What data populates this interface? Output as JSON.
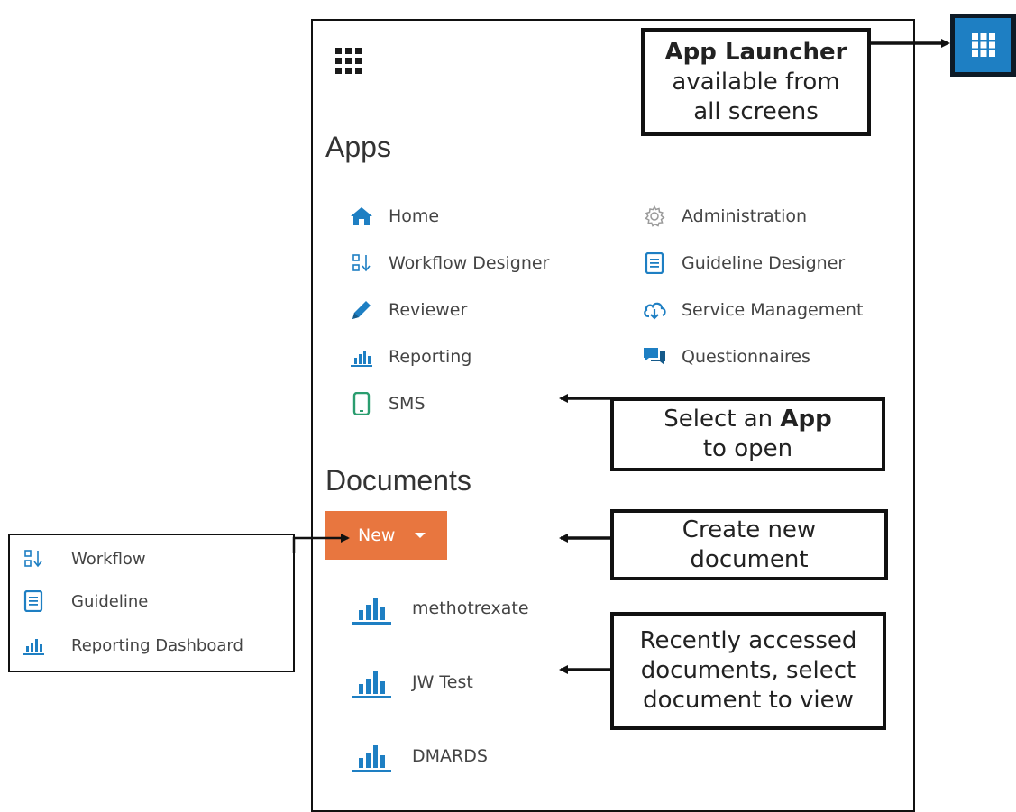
{
  "panel": {
    "apps_heading": "Apps",
    "apps": [
      {
        "label": "Home",
        "icon": "home-icon"
      },
      {
        "label": "Workflow Designer",
        "icon": "workflow-icon"
      },
      {
        "label": "Reviewer",
        "icon": "pencil-icon"
      },
      {
        "label": "Reporting",
        "icon": "bar-chart-icon"
      },
      {
        "label": "SMS",
        "icon": "phone-icon"
      },
      {
        "label": "Administration",
        "icon": "gear-icon"
      },
      {
        "label": "Guideline Designer",
        "icon": "document-icon"
      },
      {
        "label": "Service Management",
        "icon": "cloud-icon"
      },
      {
        "label": "Questionnaires",
        "icon": "chat-icon"
      }
    ],
    "documents_heading": "Documents",
    "new_button": "New",
    "documents": [
      {
        "label": "methotrexate",
        "icon": "bar-chart-icon"
      },
      {
        "label": "JW Test",
        "icon": "bar-chart-icon"
      },
      {
        "label": "DMARDS",
        "icon": "bar-chart-icon"
      }
    ]
  },
  "new_menu": {
    "items": [
      {
        "label": "Workflow",
        "icon": "workflow-icon"
      },
      {
        "label": "Guideline",
        "icon": "document-icon"
      },
      {
        "label": "Reporting Dashboard",
        "icon": "bar-chart-icon"
      }
    ]
  },
  "callouts": {
    "launcher": {
      "bold": "App Launcher",
      "line2": "available from",
      "line3": "all screens"
    },
    "select_app": {
      "pre": "Select an ",
      "bold": "App",
      "line2": "to open"
    },
    "create_doc": {
      "line1": "Create new",
      "line2": "document"
    },
    "recent_docs": {
      "line1": "Recently accessed",
      "line2": "documents, select",
      "line3": "document to view"
    }
  },
  "colors": {
    "accent_blue": "#1e7fc3",
    "new_button": "#e8763f",
    "sms_green": "#2a9d6f"
  }
}
